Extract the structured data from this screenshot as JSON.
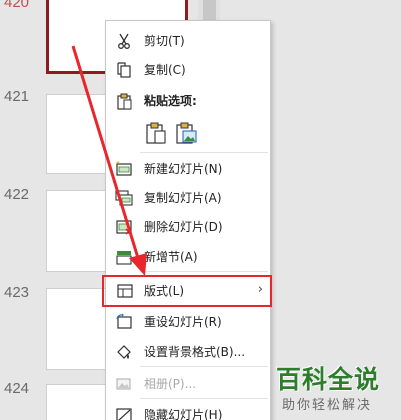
{
  "slides": [
    {
      "number": "420",
      "selected": true
    },
    {
      "number": "421",
      "selected": false
    },
    {
      "number": "422",
      "selected": false
    },
    {
      "number": "423",
      "selected": false
    },
    {
      "number": "424",
      "selected": false
    }
  ],
  "context_menu": {
    "cut": {
      "label": "剪切(T)",
      "icon": "scissors-icon"
    },
    "copy": {
      "label": "复制(C)",
      "icon": "copy-icon"
    },
    "paste_options": {
      "label": "粘贴选项:",
      "icon": "clipboard-icon",
      "buttons": [
        {
          "name": "use-destination-theme",
          "icon": "paste-keep-icon"
        },
        {
          "name": "picture",
          "icon": "paste-picture-icon"
        }
      ]
    },
    "new_slide": {
      "label": "新建幻灯片(N)",
      "icon": "new-slide-icon"
    },
    "duplicate_slide": {
      "label": "复制幻灯片(A)",
      "icon": "duplicate-slide-icon"
    },
    "delete_slide": {
      "label": "删除幻灯片(D)",
      "icon": "delete-slide-icon"
    },
    "add_section": {
      "label": "新增节(A)",
      "icon": "section-icon"
    },
    "layout": {
      "label": "版式(L)",
      "icon": "layout-icon",
      "has_submenu": true,
      "highlighted": true
    },
    "reset_slide": {
      "label": "重设幻灯片(R)",
      "icon": "reset-slide-icon"
    },
    "format_background": {
      "label": "设置背景格式(B)...",
      "icon": "format-background-icon"
    },
    "photo_album": {
      "label": "相册(P)...",
      "icon": "photo-album-icon",
      "disabled": true
    },
    "hide_slide": {
      "label": "隐藏幻灯片(H)",
      "icon": "hide-slide-icon"
    }
  },
  "watermark": {
    "title": "百科全说",
    "subtitle": "助你轻松解决"
  },
  "colors": {
    "accent_red": "#e8262c",
    "selected_border": "#8c1c22",
    "watermark_green": "#2d7d2d"
  }
}
